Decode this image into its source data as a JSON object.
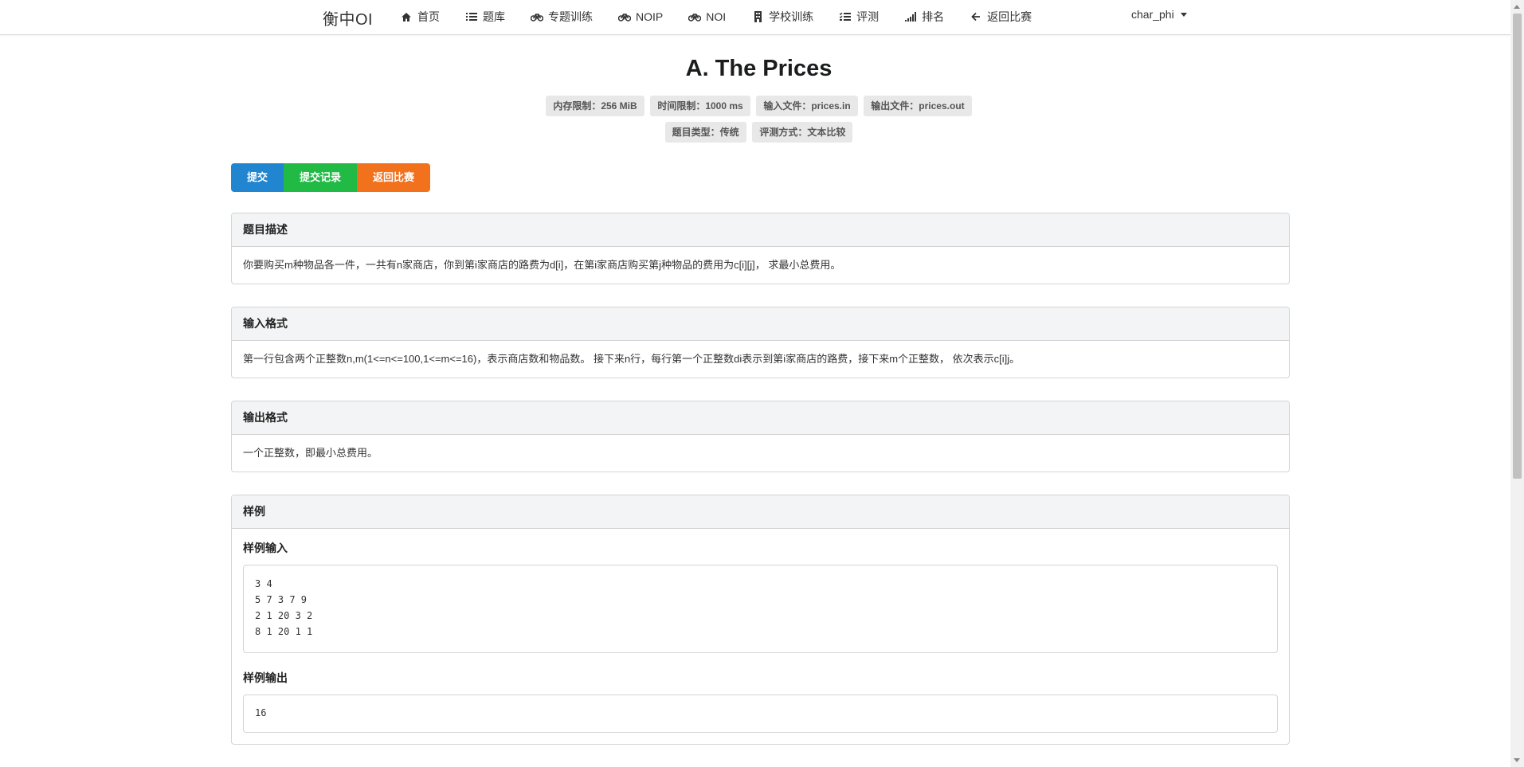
{
  "nav": {
    "brand": "衡中OI",
    "items": [
      {
        "label": "首页",
        "icon": "home-icon"
      },
      {
        "label": "题库",
        "icon": "list-icon"
      },
      {
        "label": "专题训练",
        "icon": "bicycle-icon"
      },
      {
        "label": "NOIP",
        "icon": "bicycle-icon"
      },
      {
        "label": "NOI",
        "icon": "bicycle-icon"
      },
      {
        "label": "学校训练",
        "icon": "building-icon"
      },
      {
        "label": "评测",
        "icon": "tasks-icon"
      },
      {
        "label": "排名",
        "icon": "signal-icon"
      },
      {
        "label": "返回比赛",
        "icon": "arrow-left-icon"
      }
    ],
    "user": "char_phi"
  },
  "problem": {
    "title": "A. The Prices",
    "labels_row1": [
      "内存限制：256 MiB",
      "时间限制：1000 ms",
      "输入文件：prices.in",
      "输出文件：prices.out"
    ],
    "labels_row2": [
      "题目类型：传统",
      "评测方式：文本比较"
    ]
  },
  "buttons": {
    "submit": "提交",
    "records": "提交记录",
    "back": "返回比赛"
  },
  "sections": {
    "description": {
      "title": "题目描述",
      "text": "你要购买m种物品各一件，一共有n家商店，你到第i家商店的路费为d[i]，在第i家商店购买第j种物品的费用为c[i][j]，  求最小总费用。"
    },
    "input": {
      "title": "输入格式",
      "text": "第一行包含两个正整数n,m(1<=n<=100,1<=m<=16)，表示商店数和物品数。 接下来n行，每行第一个正整数di表示到第i家商店的路费，接下来m个正整数，  依次表示c[i]j。"
    },
    "output": {
      "title": "输出格式",
      "text": "一个正整数，即最小总费用。"
    },
    "sample": {
      "title": "样例",
      "input_title": "样例输入",
      "input": "3 4\n5 7 3 7 9\n2 1 20 3 2\n8 1 20 1 1",
      "output_title": "样例输出",
      "output": "16"
    }
  }
}
